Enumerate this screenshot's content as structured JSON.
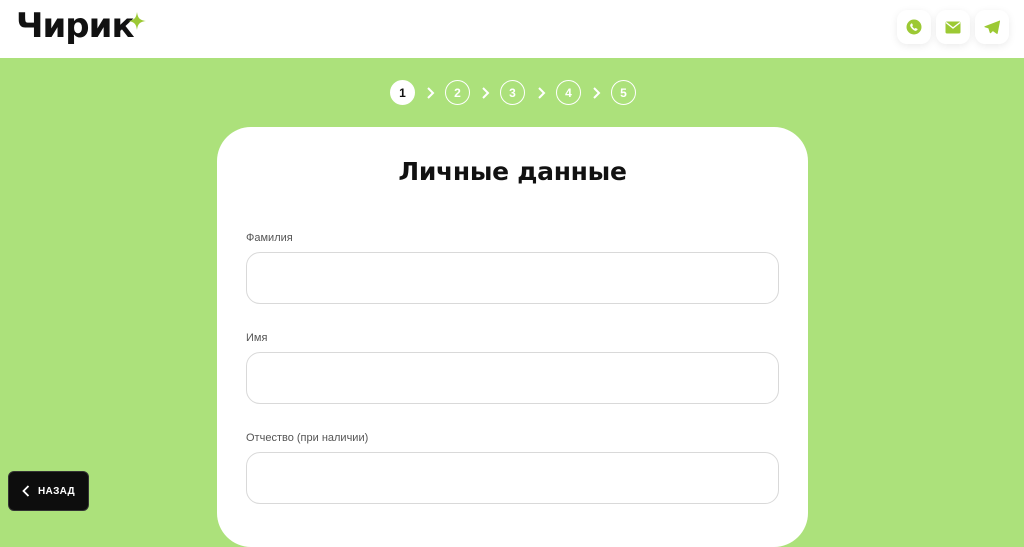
{
  "header": {
    "logo_text": "Чирик",
    "contacts": [
      {
        "name": "phone-icon",
        "color": "#9cc934"
      },
      {
        "name": "mail-icon",
        "color": "#9cc934"
      },
      {
        "name": "telegram-icon",
        "color": "#9cc934"
      }
    ]
  },
  "stepper": {
    "steps": [
      "1",
      "2",
      "3",
      "4",
      "5"
    ],
    "active_step": 1
  },
  "form": {
    "title": "Личные данные",
    "fields": [
      {
        "label": "Фамилия",
        "value": ""
      },
      {
        "label": "Имя",
        "value": ""
      },
      {
        "label": "Отчество (при наличии)",
        "value": ""
      }
    ]
  },
  "nav": {
    "back_label": "НАЗАД"
  },
  "colors": {
    "background": "#ace17b",
    "accent": "#9cc934",
    "card": "#ffffff",
    "text": "#111111"
  }
}
